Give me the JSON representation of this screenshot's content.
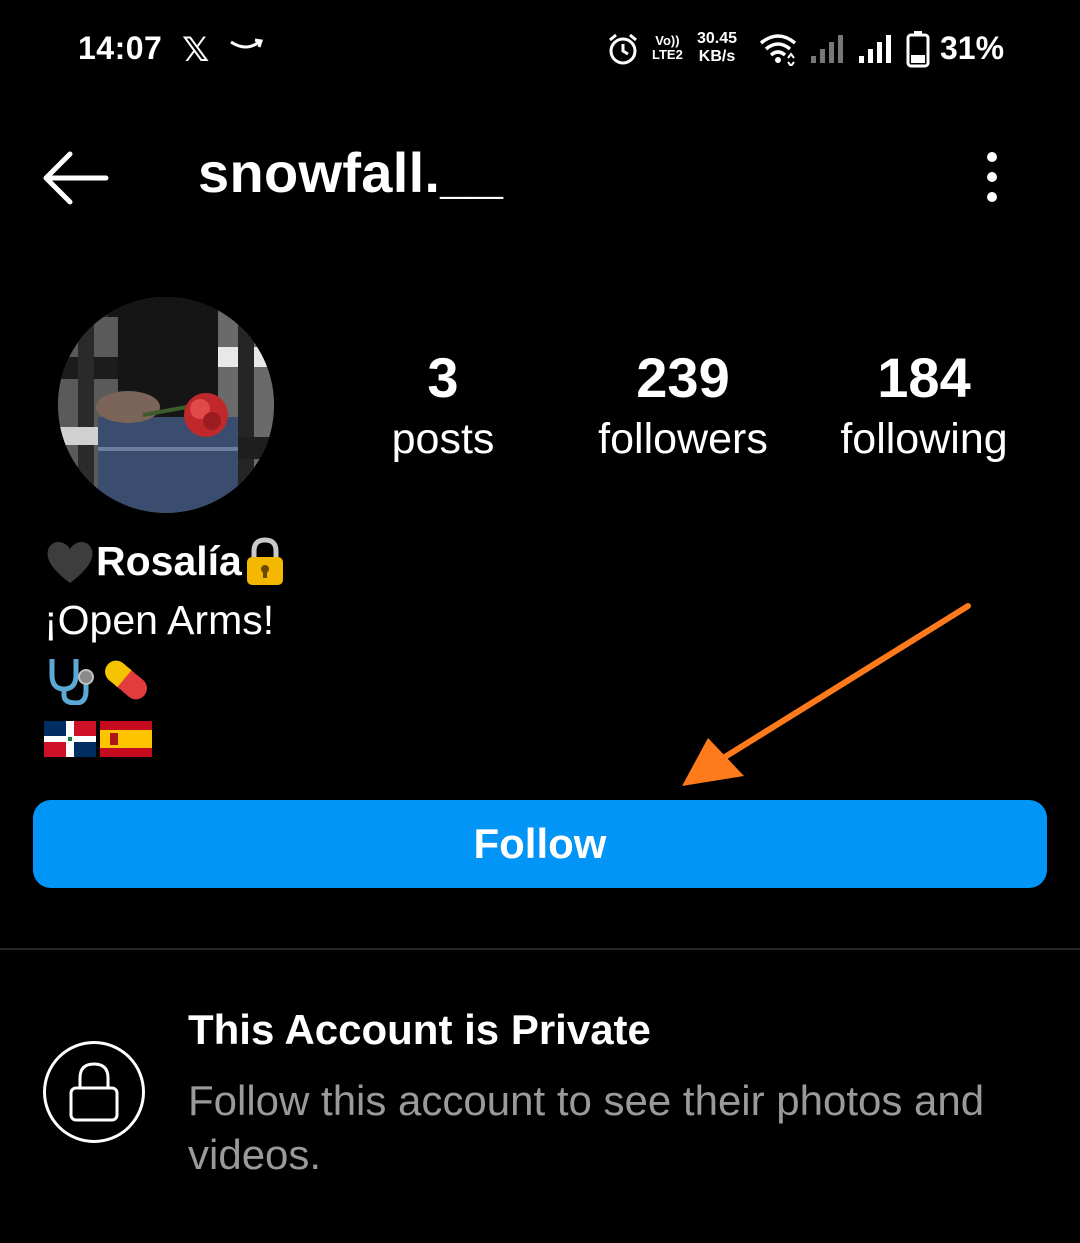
{
  "status_bar": {
    "time": "14:07",
    "x_app_icon": "x-logo-icon",
    "amazon_icon": "amazon-smile-icon",
    "volte_line1": "Vo))",
    "volte_line2": "LTE2",
    "speed_value": "30.45",
    "speed_unit": "KB/s",
    "battery_percent": "31%"
  },
  "header": {
    "username": "snowfall.__"
  },
  "profile": {
    "posts_count": "3",
    "posts_label": "posts",
    "followers_count": "239",
    "followers_label": "followers",
    "following_count": "184",
    "following_label": "following"
  },
  "bio": {
    "name": "Rosalía",
    "line1": "¡Open Arms!"
  },
  "follow_button": {
    "label": "Follow",
    "color": "#0095f6"
  },
  "private_notice": {
    "title": "This Account is Private",
    "subtitle": "Follow this account to see their photos and videos."
  },
  "annotation": {
    "arrow_color": "#ff7a1a"
  }
}
